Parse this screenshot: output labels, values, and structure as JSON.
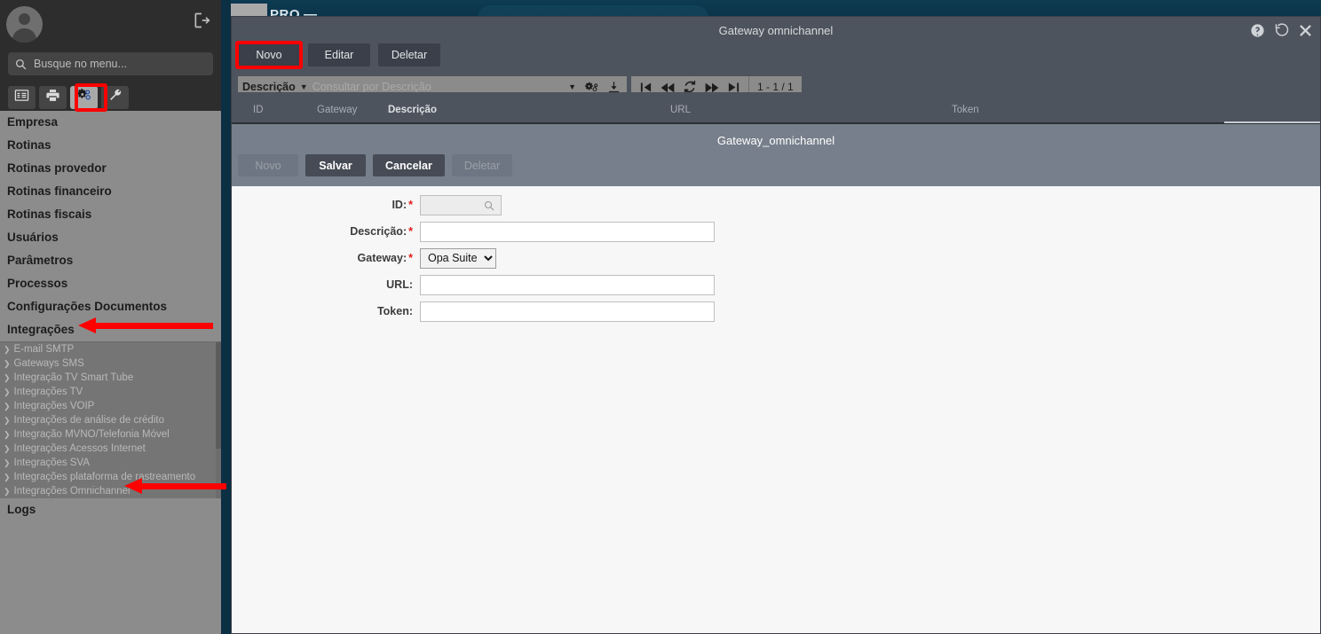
{
  "app": {
    "brand": "PRO",
    "logo_name": "app-logo"
  },
  "sidebar": {
    "search_placeholder": "Busque no menu...",
    "search_value": "",
    "tabs": [
      {
        "name": "list-icon",
        "label": "Menu lista"
      },
      {
        "name": "printer-icon",
        "label": "Impressão"
      },
      {
        "name": "gears-icon",
        "label": "Configurações"
      },
      {
        "name": "wrench-icon",
        "label": "Ferramentas"
      }
    ],
    "active_tab_index": 2,
    "items": [
      "Empresa",
      "Rotinas",
      "Rotinas provedor",
      "Rotinas financeiro",
      "Rotinas fiscais",
      "Usuários",
      "Parâmetros",
      "Processos",
      "Configurações Documentos",
      "Integrações"
    ],
    "submenu": [
      "E-mail SMTP",
      "Gateways SMS",
      "Integração TV Smart Tube",
      "Integrações TV",
      "Integrações VOIP",
      "Integrações de análise de crédito",
      "Integração MVNO/Telefonia Móvel",
      "Integrações Acessos Internet",
      "Integrações SVA",
      "Integrações plataforma de rastreamento",
      "Integrações Omnichannel"
    ],
    "items_after": [
      "Logs"
    ]
  },
  "modal": {
    "title": "Gateway omnichannel",
    "controls": [
      {
        "name": "help-icon",
        "label": "Ajuda"
      },
      {
        "name": "history-icon",
        "label": "Histórico"
      },
      {
        "name": "close-icon",
        "label": "Fechar"
      }
    ],
    "toolbar": {
      "new_label": "Novo",
      "edit_label": "Editar",
      "delete_label": "Deletar"
    },
    "filter": {
      "field_label": "Descrição",
      "placeholder": "Consultar por Descrição",
      "value": "",
      "icons": [
        {
          "name": "filter-caret-icon"
        },
        {
          "name": "advanced-filter-icon"
        },
        {
          "name": "export-download-icon"
        }
      ],
      "nav_icons": [
        {
          "name": "first-page-icon"
        },
        {
          "name": "previous-page-icon"
        },
        {
          "name": "refresh-icon"
        },
        {
          "name": "next-page-icon"
        },
        {
          "name": "last-page-icon"
        }
      ],
      "record_count": "1 - 1 / 1"
    },
    "grid": {
      "columns": [
        "ID",
        "Gateway",
        "Descrição",
        "URL",
        "Token"
      ]
    },
    "detail": {
      "title": "Gateway_omnichannel",
      "buttons": [
        {
          "label": "Novo",
          "name": "detail-new-button",
          "disabled": true
        },
        {
          "label": "Salvar",
          "name": "detail-save-button",
          "disabled": false
        },
        {
          "label": "Cancelar",
          "name": "detail-cancel-button",
          "disabled": false
        },
        {
          "label": "Deletar",
          "name": "detail-delete-button",
          "disabled": true
        }
      ],
      "fields": [
        {
          "label": "ID:",
          "required": true,
          "type": "lookup",
          "value": "",
          "name": "id-field"
        },
        {
          "label": "Descrição:",
          "required": true,
          "type": "text",
          "value": "",
          "name": "descricao-field"
        },
        {
          "label": "Gateway:",
          "required": true,
          "type": "select",
          "value": "Opa Suite",
          "options": [
            "Opa Suite"
          ],
          "name": "gateway-select"
        },
        {
          "label": "URL:",
          "required": false,
          "type": "text",
          "value": "",
          "name": "url-field"
        },
        {
          "label": "Token:",
          "required": false,
          "type": "text",
          "value": "",
          "name": "token-field"
        }
      ]
    }
  },
  "annotations": {
    "highlight_color": "#fe0000",
    "boxes": [
      {
        "name": "gears-tab-highlight",
        "target": "gears-icon"
      },
      {
        "name": "novo-button-highlight",
        "target": "novo-button"
      }
    ],
    "arrows": [
      {
        "name": "arrow-integracoes",
        "target": "Integrações"
      },
      {
        "name": "arrow-integracoes-omnichannel",
        "target": "Integrações Omnichannel"
      }
    ]
  }
}
